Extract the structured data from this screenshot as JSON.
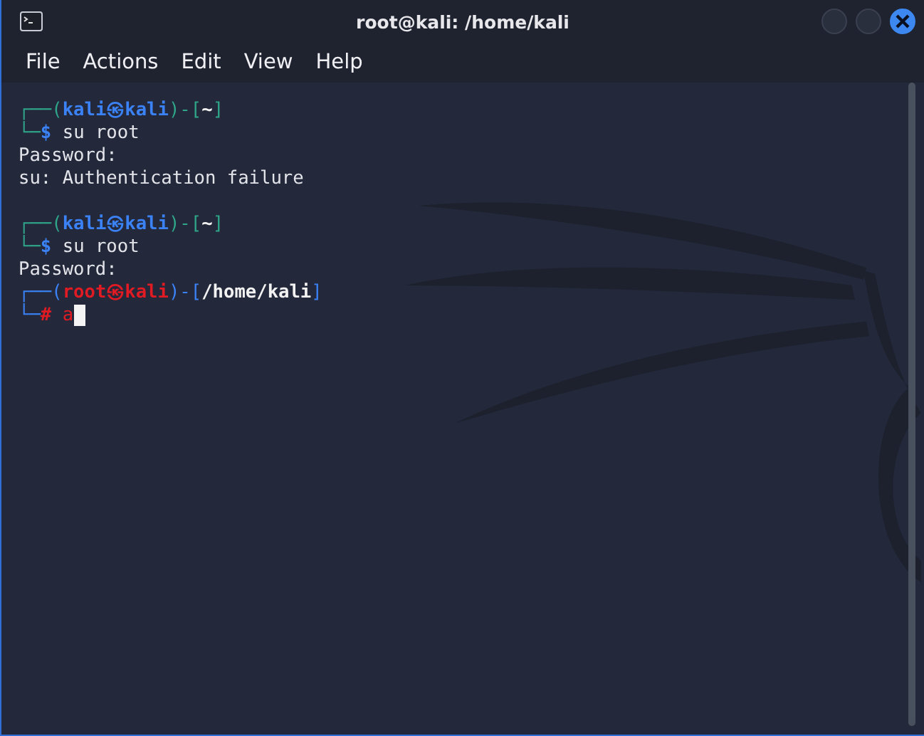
{
  "window": {
    "title": "root@kali: /home/kali"
  },
  "menu": [
    "File",
    "Actions",
    "Edit",
    "View",
    "Help"
  ],
  "terminal": [
    {
      "kind": "prompt",
      "root": false,
      "open": "┌──(",
      "user": "kali",
      "symbol": "㉿",
      "host": "kali",
      "mid": ")-[",
      "path": "~",
      "close": "]",
      "corner": "└─",
      "sign": "$",
      "command": "su root",
      "cursor": false
    },
    {
      "kind": "output",
      "text": "Password:"
    },
    {
      "kind": "output",
      "text": "su: Authentication failure"
    },
    {
      "kind": "blank"
    },
    {
      "kind": "prompt",
      "root": false,
      "open": "┌──(",
      "user": "kali",
      "symbol": "㉿",
      "host": "kali",
      "mid": ")-[",
      "path": "~",
      "close": "]",
      "corner": "└─",
      "sign": "$",
      "command": "su root",
      "cursor": false
    },
    {
      "kind": "output",
      "text": "Password:"
    },
    {
      "kind": "prompt",
      "root": true,
      "open": "┌──(",
      "user": "root",
      "symbol": "㉿",
      "host": "kali",
      "mid": ")-[",
      "path": "/home/kali",
      "close": "]",
      "corner": "└─",
      "sign": "#",
      "command": "a",
      "cursor": true
    }
  ]
}
